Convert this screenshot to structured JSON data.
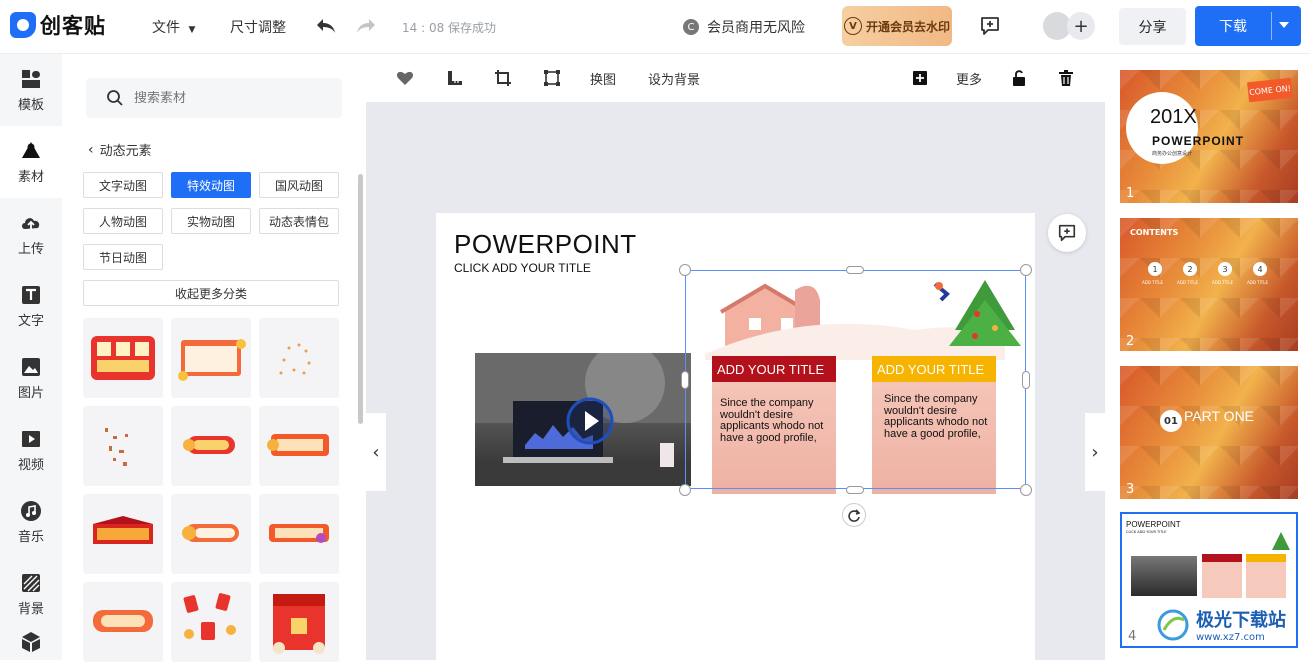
{
  "app": {
    "logo_text": "创客贴"
  },
  "topbar": {
    "menu_file": "文件",
    "menu_resize": "尺寸调整",
    "save_status": "14 : 08 保存成功",
    "commercial_text": "会员商用无风险",
    "vip_label": "开通会员去水印",
    "share_label": "分享",
    "download_label": "下载"
  },
  "rail": {
    "items": [
      {
        "label": "模板",
        "icon": "template-icon"
      },
      {
        "label": "素材",
        "icon": "material-icon"
      },
      {
        "label": "上传",
        "icon": "upload-cloud-icon"
      },
      {
        "label": "文字",
        "icon": "text-icon"
      },
      {
        "label": "图片",
        "icon": "image-icon"
      },
      {
        "label": "视频",
        "icon": "video-icon"
      },
      {
        "label": "音乐",
        "icon": "music-icon"
      },
      {
        "label": "背景",
        "icon": "background-icon"
      }
    ]
  },
  "panel": {
    "search_placeholder": "搜索素材",
    "back_label": "动态元素",
    "tags": [
      "文字动图",
      "特效动图",
      "国风动图",
      "人物动图",
      "实物动图",
      "动态表情包",
      "节日动图"
    ],
    "active_tag": "特效动图",
    "collapse_label": "收起更多分类"
  },
  "edit_toolbar": {
    "replace_label": "换图",
    "set_bg_label": "设为背景",
    "more_label": "更多"
  },
  "slide": {
    "title": "POWERPOINT",
    "subtitle": "CLICK ADD YOUR TITLE",
    "card_left_title": "ADD YOUR TITLE",
    "card_left_body": "Since the company wouldn't desire applicants whodo not have a good profile,",
    "card_right_title": "ADD YOUR TITLE",
    "card_right_body": "Since the company wouldn't desire applicants whodo not have a good profile,"
  },
  "pages": {
    "items": [
      {
        "num": "1",
        "title": "201X",
        "heading": "POWERPOINT",
        "sub": "商务办公创意设计",
        "tag": "COME ON!"
      },
      {
        "num": "2",
        "heading": "CONTENTS",
        "steps": [
          "1",
          "2",
          "3",
          "4"
        ],
        "step_label": "ADD TITLE"
      },
      {
        "num": "3",
        "badge": "01",
        "heading": "PART ONE"
      },
      {
        "num": "4",
        "heading": "POWERPOINT",
        "sub": "CLICK ADD YOUR TITLE"
      }
    ]
  },
  "watermark": {
    "text": "极光下载站",
    "url": "www.xz7.com"
  },
  "colors": {
    "accent": "#1f6ff6",
    "card_red": "#b3121c",
    "card_yellow": "#f6b400"
  }
}
